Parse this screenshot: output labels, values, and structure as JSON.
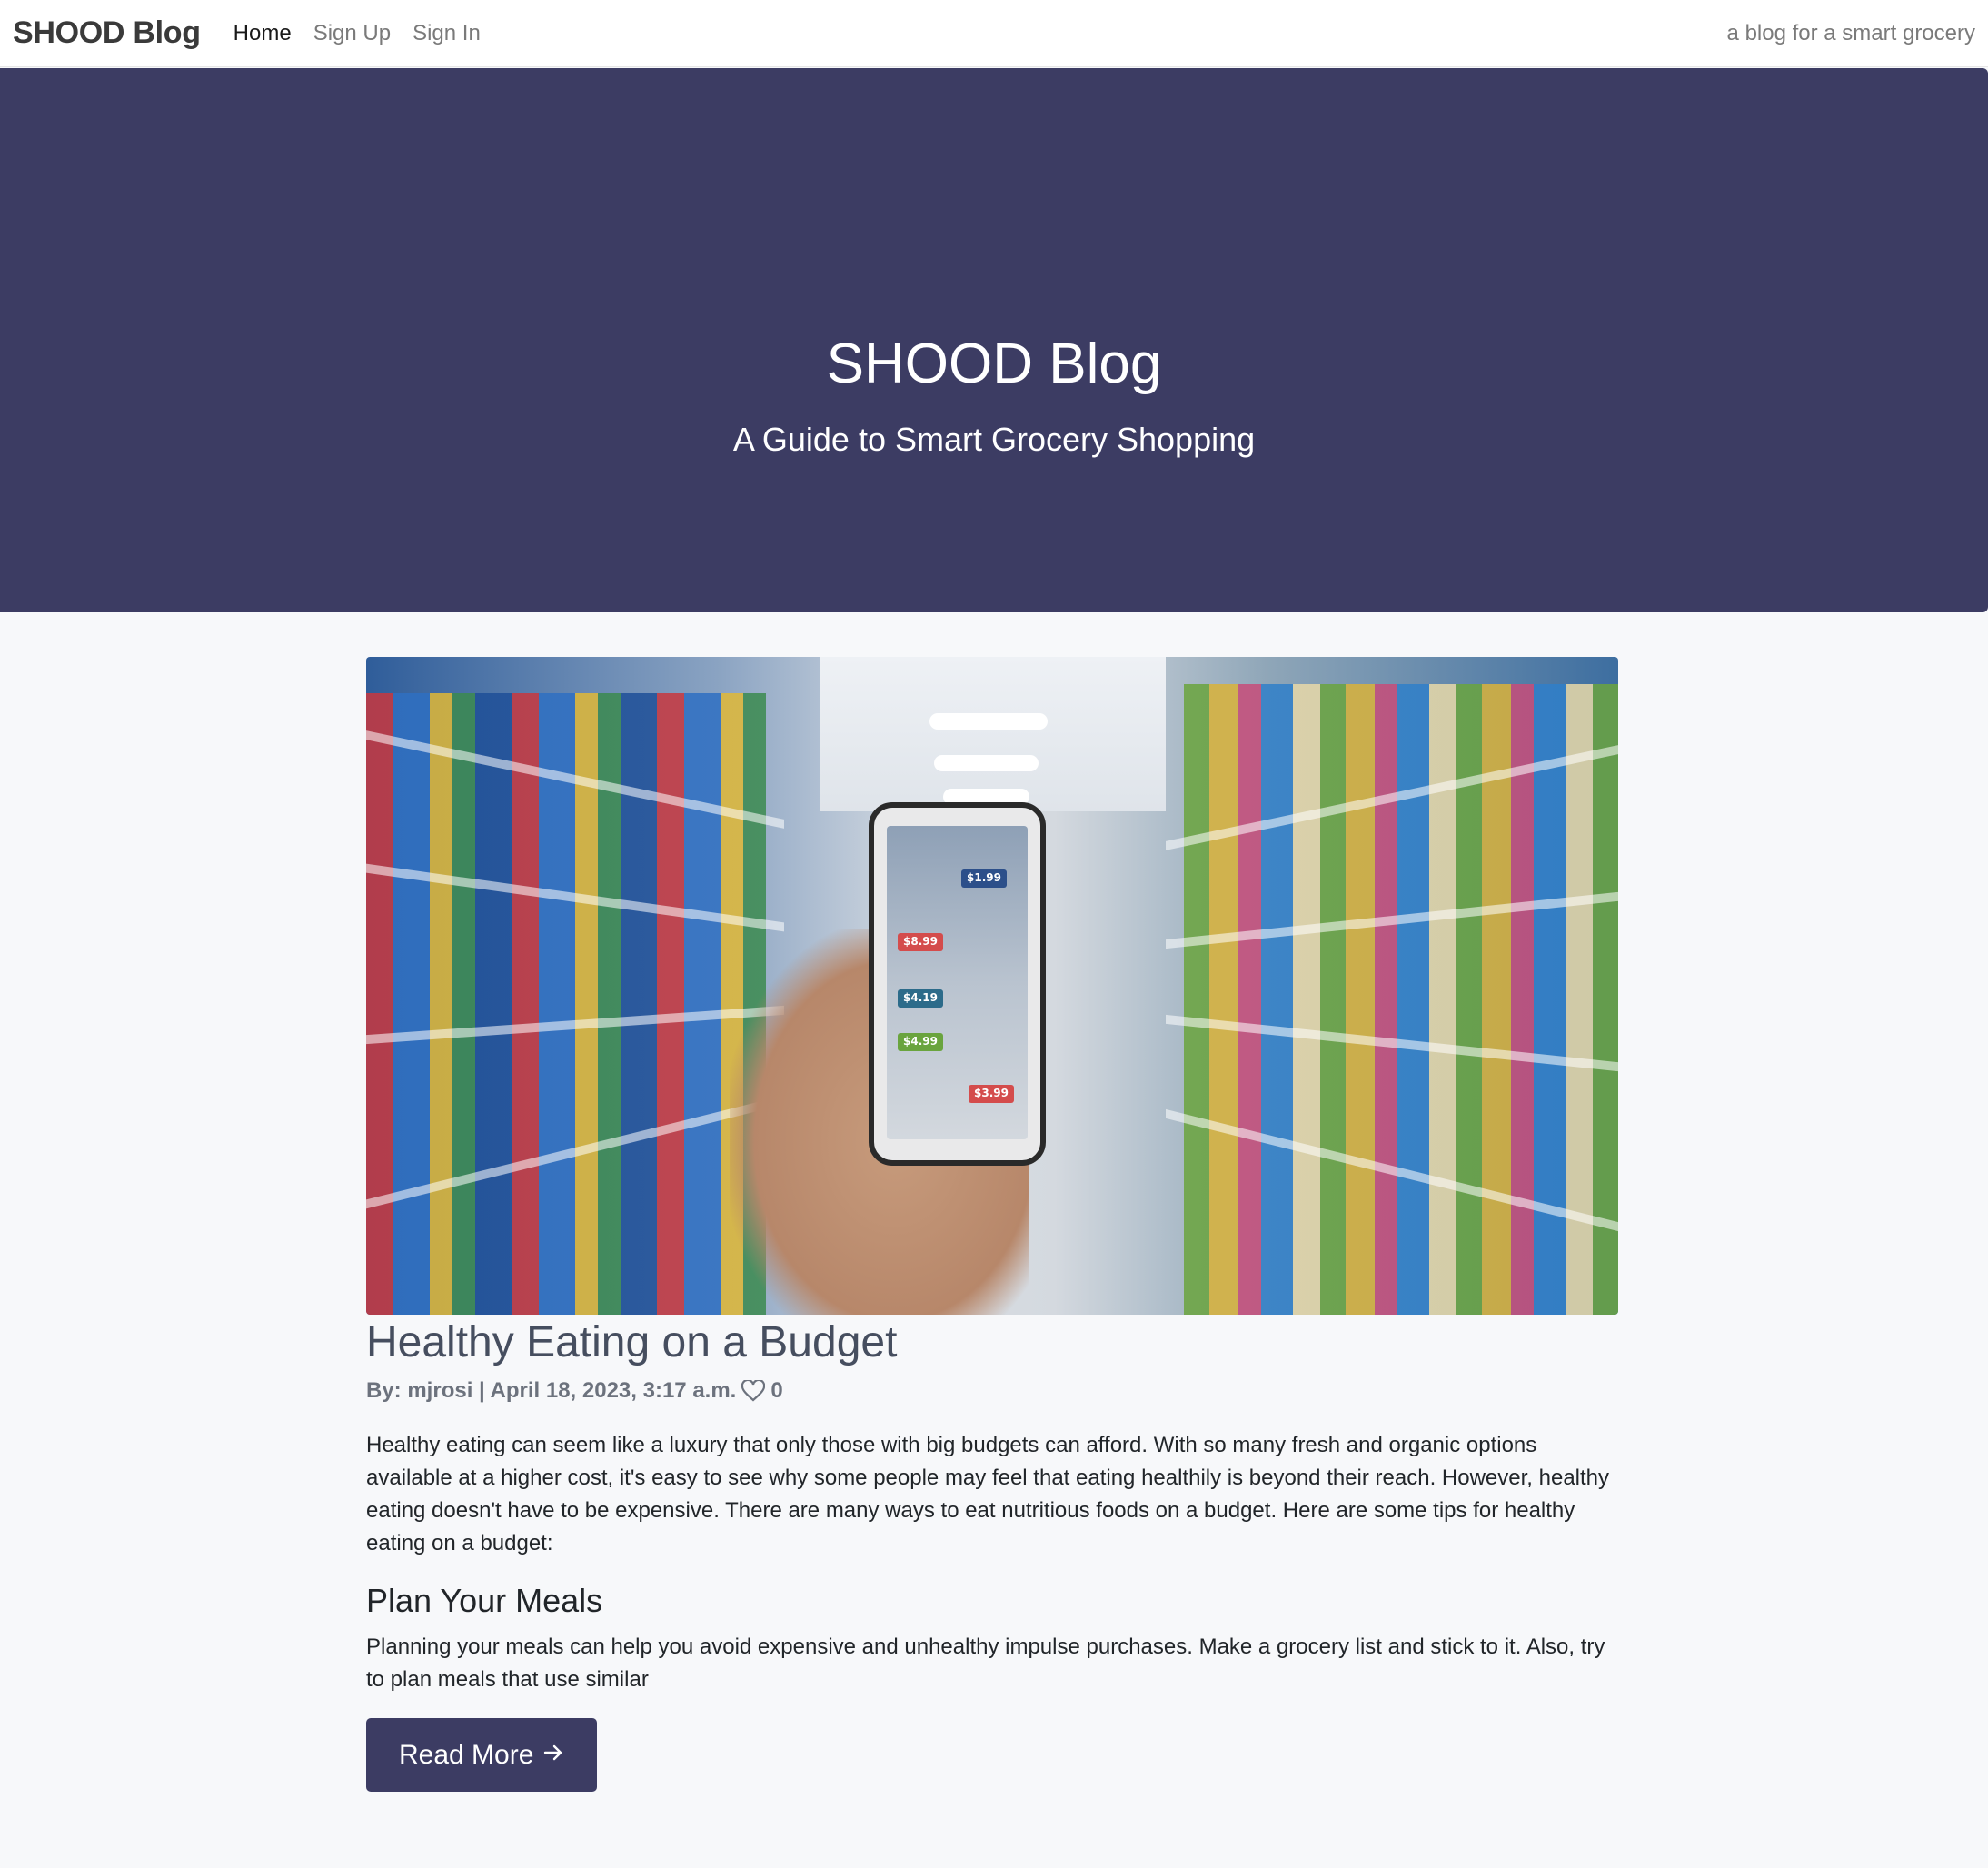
{
  "navbar": {
    "brand": "SHOOD Blog",
    "links": [
      {
        "label": "Home",
        "active": true
      },
      {
        "label": "Sign Up",
        "active": false
      },
      {
        "label": "Sign In",
        "active": false
      }
    ],
    "tagline": "a blog for a smart grocery"
  },
  "hero": {
    "title": "SHOOD Blog",
    "subtitle": "A Guide to Smart Grocery Shopping",
    "background_color": "#3c3c63"
  },
  "post": {
    "image_tags": [
      "$1.99",
      "$8.99",
      "$4.19",
      "$4.99",
      "$3.99"
    ],
    "title": "Healthy Eating on a Budget",
    "meta": "By: mjrosi | April 18, 2023, 3:17 a.m.",
    "like_icon": "heart-icon",
    "likes": "0",
    "intro": "Healthy eating can seem like a luxury that only those with big budgets can afford. With so many fresh and organic options available at a higher cost, it's easy to see why some people may feel that eating healthily is beyond their reach. However, healthy eating doesn't have to be expensive. There are many ways to eat nutritious foods on a budget. Here are some tips for healthy eating on a budget:",
    "section_heading": "Plan Your Meals",
    "section_text": "Planning your meals can help you avoid expensive and unhealthy impulse purchases. Make a grocery list and stick to it. Also, try to plan meals that use similar",
    "read_more_label": "Read More",
    "read_more_icon": "arrow-right-icon"
  }
}
